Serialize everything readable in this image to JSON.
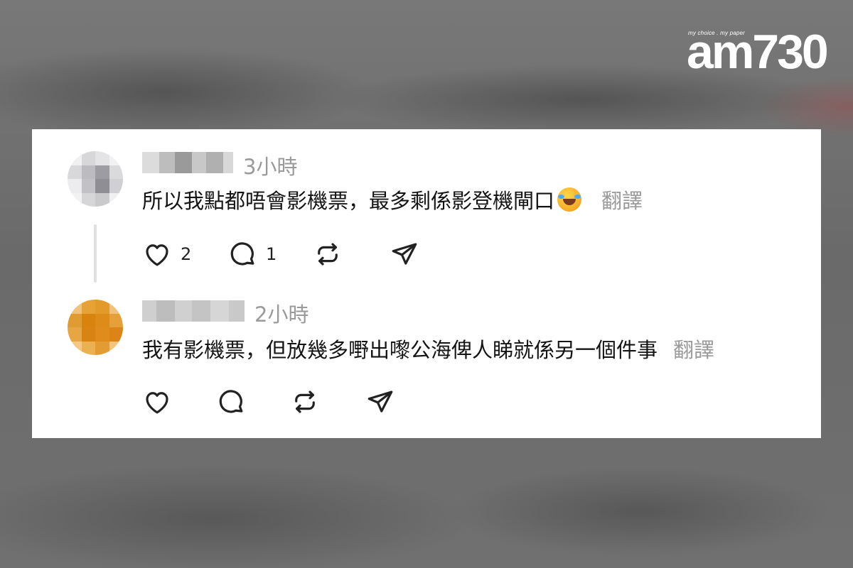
{
  "branding": {
    "logo_text": "am730",
    "tagline": "my choice . my paper"
  },
  "comments": [
    {
      "time": "3小時",
      "text": "所以我點都唔會影機票，最多剩係影登機閘口",
      "emoji": "rolling-on-floor-laughing-emoji",
      "translate_label": "翻譯",
      "likes": "2",
      "replies": "1",
      "avatar_colors": [
        "#f0f0f0",
        "#d7d7d9",
        "#e4e4e6",
        "#f2f2f2",
        "#d8d8da",
        "#bcbcc0",
        "#9c9ca2",
        "#dadadc",
        "#ececee",
        "#c2c2c6",
        "#8e8e94",
        "#d0d0d4",
        "#f2f2f2",
        "#d6d6d8",
        "#cacacd",
        "#f0f0f0"
      ]
    },
    {
      "time": "2小時",
      "text": "我有影機票，但放幾多嘢出嚟公海俾人睇就係另一個件事",
      "translate_label": "翻譯",
      "likes": "",
      "replies": "",
      "avatar_colors": [
        "#f2c27a",
        "#e7a236",
        "#e39a2a",
        "#f1c07a",
        "#e19b33",
        "#d9830f",
        "#dd8c1a",
        "#e5a03a",
        "#e7a544",
        "#d98412",
        "#e08c1c",
        "#dc8418",
        "#f3c985",
        "#ebb050",
        "#e39c34",
        "#f2c47c"
      ]
    }
  ],
  "colors": {
    "card_bg": "#ffffff",
    "text": "#141414",
    "muted": "#9a9a9a",
    "icon": "#222222"
  }
}
